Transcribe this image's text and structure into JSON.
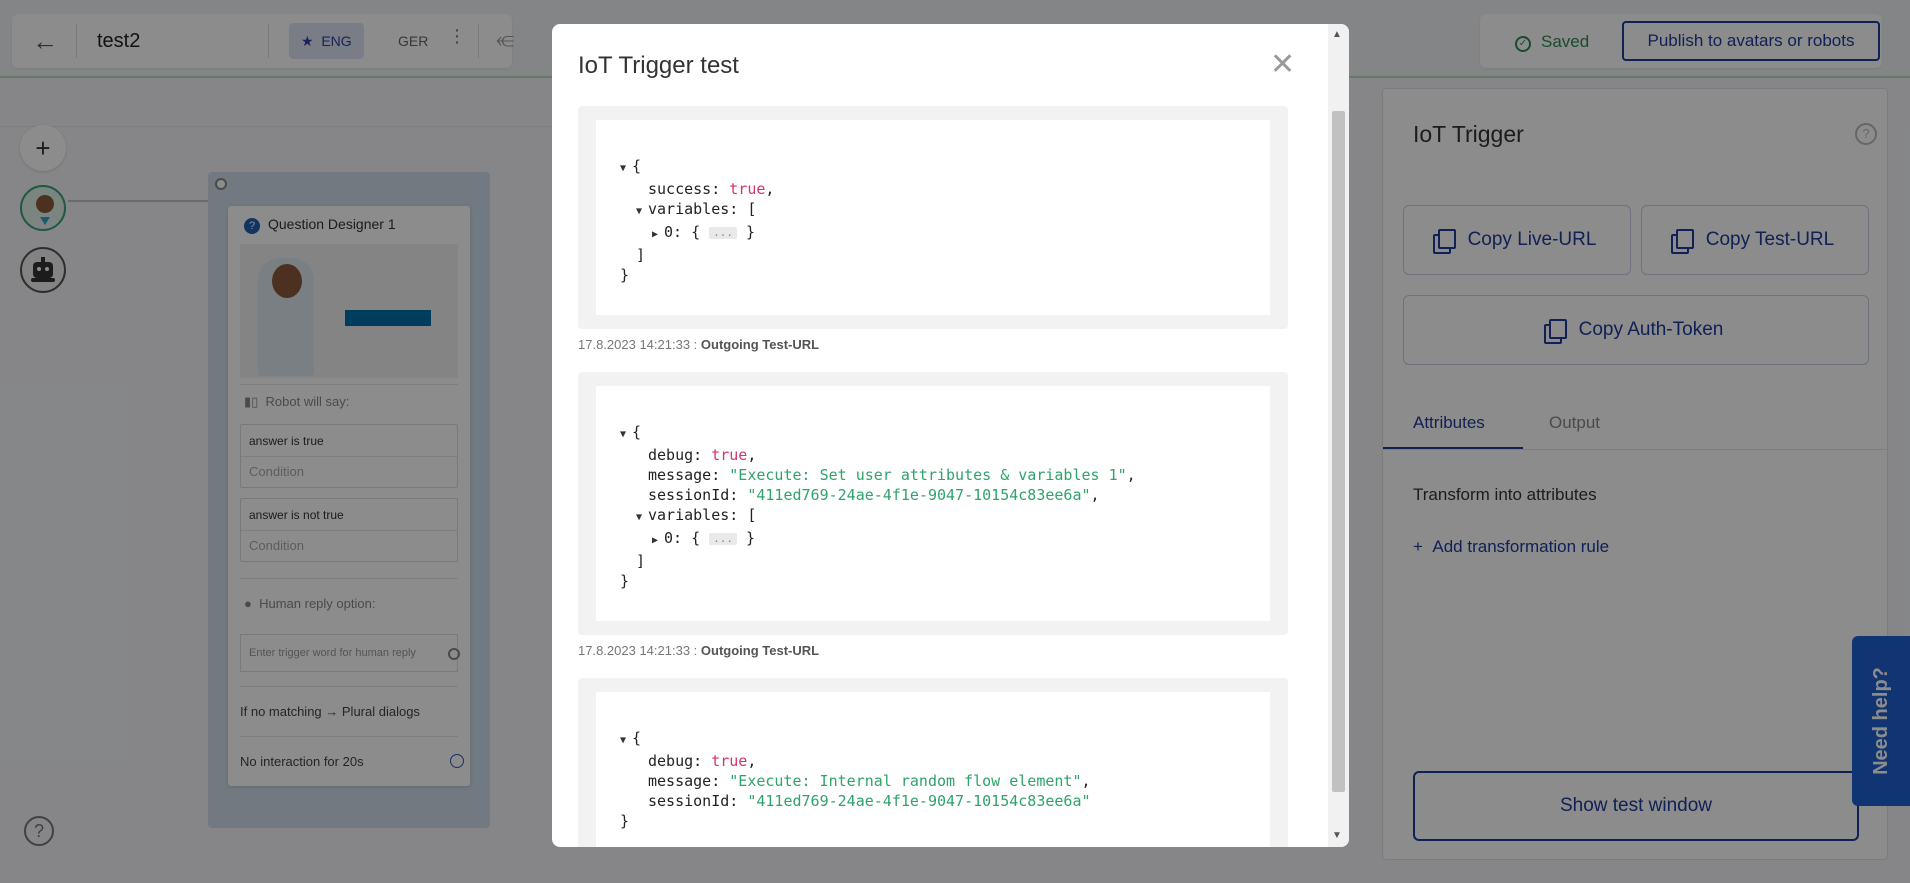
{
  "topbar": {
    "back_icon": "arrow-left-icon",
    "title": "test2",
    "lang_eng": "ENG",
    "lang_ger": "GER",
    "saved_label": "Saved",
    "publish_label": "Publish to avatars or robots"
  },
  "canvas": {
    "plus_label": "+",
    "question_designer": {
      "title": "Question Designer 1",
      "robot_will_say": "Robot will say:",
      "answers": [
        {
          "text": "answer is true",
          "condition_placeholder": "Condition"
        },
        {
          "text": "answer is not true",
          "condition_placeholder": "Condition"
        }
      ],
      "human_reply_label": "Human reply option:",
      "trigger_placeholder": "Enter trigger word for human reply",
      "no_matching": "If no matching → Plural dialogs",
      "no_interaction": "No interaction for 20s"
    }
  },
  "right_panel": {
    "title": "IoT Trigger",
    "copy_live": "Copy Live-URL",
    "copy_test": "Copy Test-URL",
    "copy_auth": "Copy Auth-Token",
    "tab_attributes": "Attributes",
    "tab_output": "Output",
    "transform_label": "Transform into attributes",
    "add_rule": "Add transformation rule",
    "show_test": "Show test window",
    "need_help": "Need help?"
  },
  "modal": {
    "title": "IoT Trigger test",
    "close_icon": "close-icon",
    "entries": [
      {
        "lines": [
          {
            "indent": 0,
            "tri": "down",
            "text": "{"
          },
          {
            "indent": 1,
            "key": "success",
            "bool": "true",
            "tail": ","
          },
          {
            "indent": 1,
            "tri": "down",
            "key": "variables",
            "text": "["
          },
          {
            "indent": 2,
            "tri": "right",
            "key": "0",
            "collapsed": "..."
          },
          {
            "indent": 1,
            "text": "]"
          },
          {
            "indent": 0,
            "text": "}"
          }
        ],
        "timestamp": "17.8.2023 14:21:33 :",
        "direction": "Outgoing Test-URL"
      },
      {
        "lines": [
          {
            "indent": 0,
            "tri": "down",
            "text": "{"
          },
          {
            "indent": 1,
            "key": "debug",
            "bool": "true",
            "tail": ","
          },
          {
            "indent": 1,
            "key": "message",
            "str": "\"Execute: Set user attributes & variables 1\"",
            "tail": ","
          },
          {
            "indent": 1,
            "key": "sessionId",
            "str": "\"411ed769-24ae-4f1e-9047-10154c83ee6a\"",
            "tail": ","
          },
          {
            "indent": 1,
            "tri": "down",
            "key": "variables",
            "text": "["
          },
          {
            "indent": 2,
            "tri": "right",
            "key": "0",
            "collapsed": "..."
          },
          {
            "indent": 1,
            "text": "]"
          },
          {
            "indent": 0,
            "text": "}"
          }
        ],
        "timestamp": "17.8.2023 14:21:33 :",
        "direction": "Outgoing Test-URL"
      },
      {
        "lines": [
          {
            "indent": 0,
            "tri": "down",
            "text": "{"
          },
          {
            "indent": 1,
            "key": "debug",
            "bool": "true",
            "tail": ","
          },
          {
            "indent": 1,
            "key": "message",
            "str": "\"Execute: Internal random flow element\"",
            "tail": ","
          },
          {
            "indent": 1,
            "key": "sessionId",
            "str": "\"411ed769-24ae-4f1e-9047-10154c83ee6a\""
          },
          {
            "indent": 0,
            "text": "}"
          }
        ],
        "timestamp": "",
        "direction": ""
      }
    ]
  }
}
